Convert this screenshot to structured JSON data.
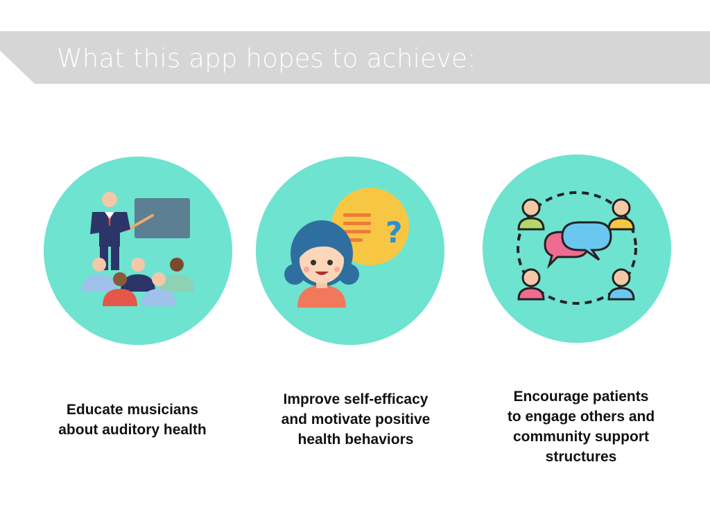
{
  "slide": {
    "title": "What this app hopes to achieve:"
  },
  "goals": [
    {
      "icon": "teacher-presentation-icon",
      "lines": [
        "Educate musicians",
        "about auditory health"
      ]
    },
    {
      "icon": "person-question-icon",
      "lines": [
        "Improve self-efficacy",
        "and motivate positive",
        "health behaviors"
      ]
    },
    {
      "icon": "community-chat-icon",
      "lines": [
        "Encourage patients",
        "to engage others and",
        "community support",
        "structures"
      ]
    }
  ],
  "colors": {
    "title_band": "#d6d6d6",
    "circle": "#6ee3d0",
    "caption_text": "#111111"
  }
}
